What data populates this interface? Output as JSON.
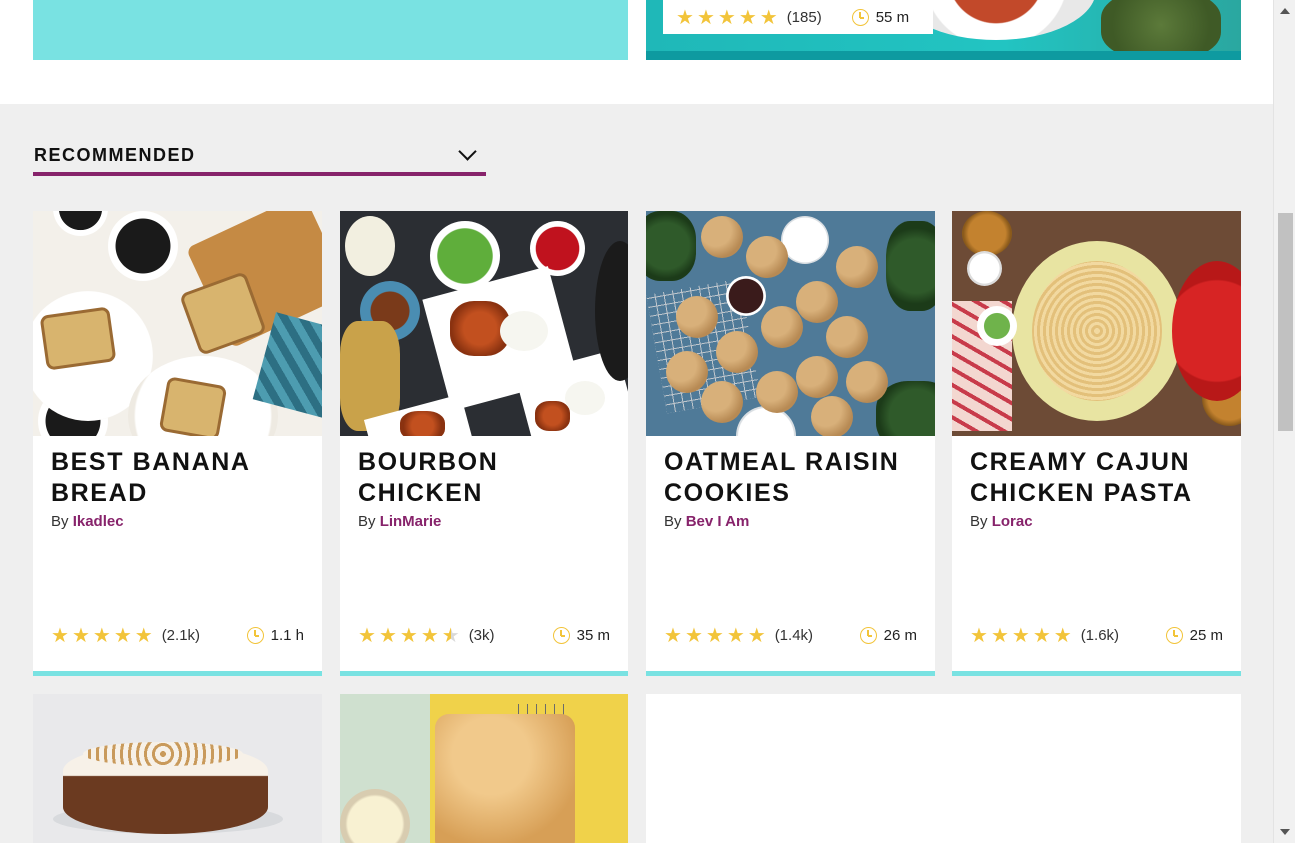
{
  "top_card": {
    "rating_stars": 5,
    "count": "(185)",
    "time": "55 m"
  },
  "sort": {
    "label": "RECOMMENDED",
    "icon": "chevron-down-icon"
  },
  "recipes": [
    {
      "title": "BEST BANANA BREAD",
      "by_prefix": "By",
      "author": "Ikadlec",
      "rating": 5,
      "count": "(2.1k)",
      "time": "1.1 h"
    },
    {
      "title": "BOURBON CHICKEN",
      "by_prefix": "By",
      "author": "LinMarie",
      "rating": 4.5,
      "count": "(3k)",
      "time": "35 m"
    },
    {
      "title": "OATMEAL RAISIN COOKIES",
      "by_prefix": "By",
      "author": "Bev I Am",
      "rating": 5,
      "count": "(1.4k)",
      "time": "26 m"
    },
    {
      "title": "CREAMY CAJUN CHICKEN PASTA",
      "by_prefix": "By",
      "author": "Lorac",
      "rating": 5,
      "count": "(1.6k)",
      "time": "25 m"
    }
  ],
  "colors": {
    "accent": "#87236b",
    "card_border": "#79e2e2",
    "star": "#f2c43a"
  }
}
